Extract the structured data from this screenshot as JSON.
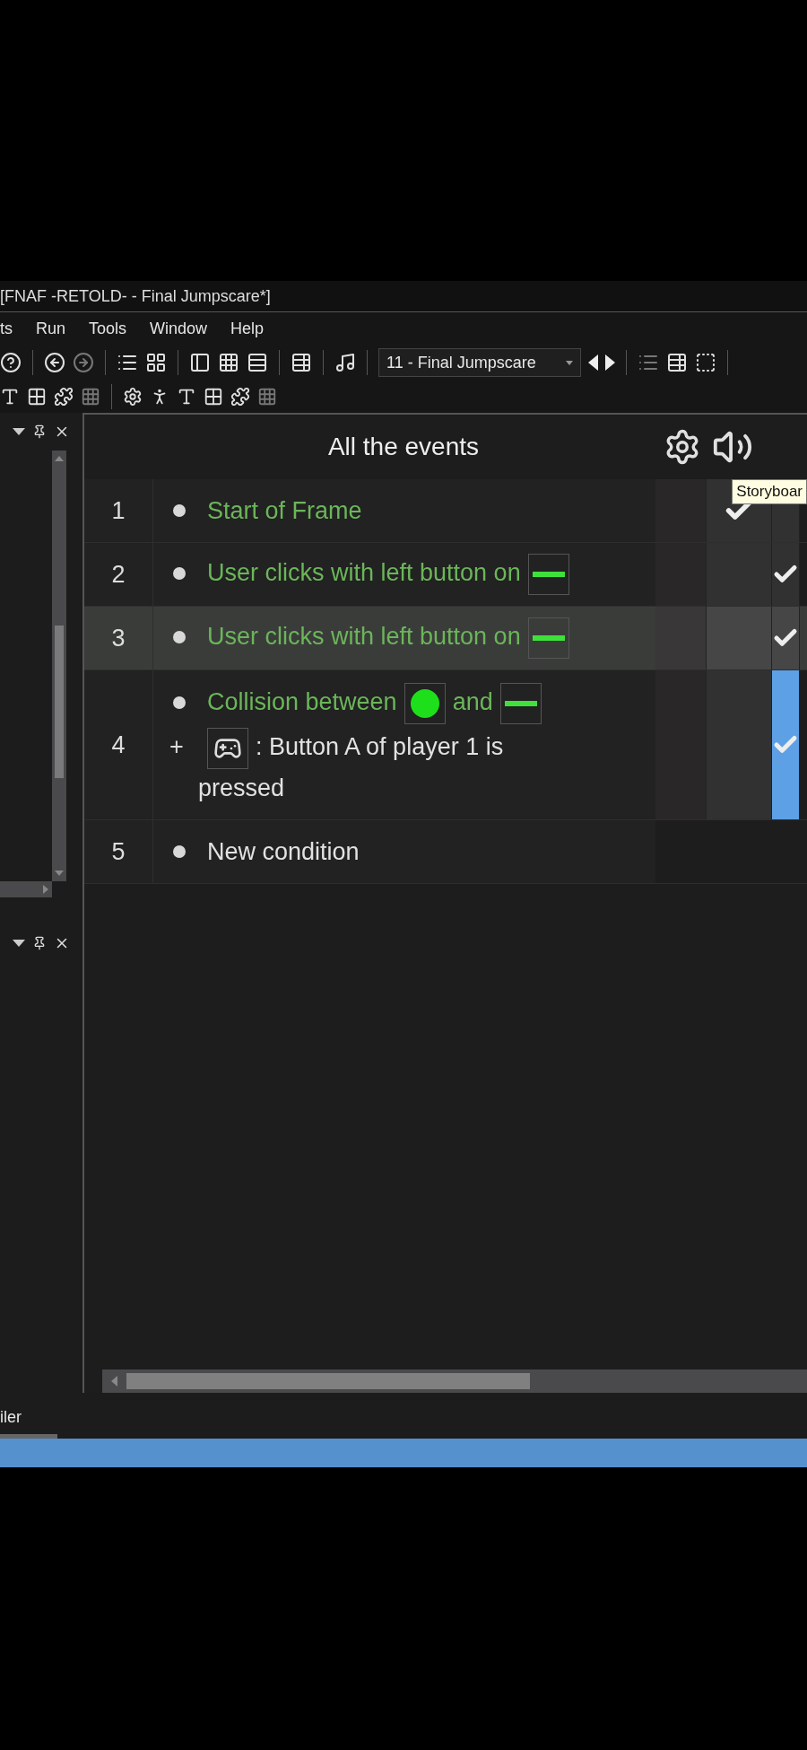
{
  "window": {
    "title": "[FNAF -RETOLD- - Final Jumpscare*]"
  },
  "menu": [
    {
      "label": "ts"
    },
    {
      "label": "Run"
    },
    {
      "label": "Tools"
    },
    {
      "label": "Window"
    },
    {
      "label": "Help"
    }
  ],
  "toolbar": {
    "frame_select": {
      "value": "11 - Final Jumpscare"
    }
  },
  "events": {
    "title": "All the events",
    "tooltip": "Storyboar",
    "rows": [
      {
        "number": "1",
        "hovered": false,
        "conditions": [
          {
            "kind": "object",
            "segments": [
              {
                "kind": "text",
                "text": "Start of Frame"
              }
            ]
          }
        ],
        "cells": [
          {
            "checked": false,
            "selected": false
          },
          {
            "checked": true,
            "selected": false
          },
          {
            "checked": false,
            "selected": false
          }
        ]
      },
      {
        "number": "2",
        "hovered": false,
        "conditions": [
          {
            "kind": "object",
            "segments": [
              {
                "kind": "text",
                "text": "User clicks with left button on"
              },
              {
                "kind": "bar"
              }
            ]
          }
        ],
        "cells": [
          {
            "checked": false,
            "selected": false
          },
          {
            "checked": false,
            "selected": false
          },
          {
            "checked": true,
            "selected": false
          }
        ]
      },
      {
        "number": "3",
        "hovered": true,
        "conditions": [
          {
            "kind": "object",
            "segments": [
              {
                "kind": "text",
                "text": "User clicks with left button on"
              },
              {
                "kind": "bar"
              }
            ]
          }
        ],
        "cells": [
          {
            "checked": false,
            "selected": false
          },
          {
            "checked": false,
            "selected": false
          },
          {
            "checked": true,
            "selected": false
          }
        ]
      },
      {
        "number": "4",
        "hovered": false,
        "conditions": [
          {
            "kind": "object",
            "segments": [
              {
                "kind": "text",
                "text": "Collision between"
              },
              {
                "kind": "ball"
              },
              {
                "kind": "text",
                "text": "and"
              },
              {
                "kind": "bar"
              }
            ]
          },
          {
            "kind": "general",
            "marker": "+",
            "segments": [
              {
                "kind": "gamepad"
              },
              {
                "kind": "text",
                "text": ": Button A of player 1 is"
              },
              {
                "kind": "text",
                "text": "pressed"
              }
            ]
          }
        ],
        "cells": [
          {
            "checked": false,
            "selected": false
          },
          {
            "checked": false,
            "selected": false
          },
          {
            "checked": true,
            "selected": true
          }
        ]
      },
      {
        "number": "5",
        "hovered": false,
        "conditions": [
          {
            "kind": "general",
            "segments": [
              {
                "kind": "text",
                "text": "New condition"
              }
            ]
          }
        ],
        "cells": []
      }
    ]
  },
  "bottom_tab": {
    "label": "iler"
  }
}
